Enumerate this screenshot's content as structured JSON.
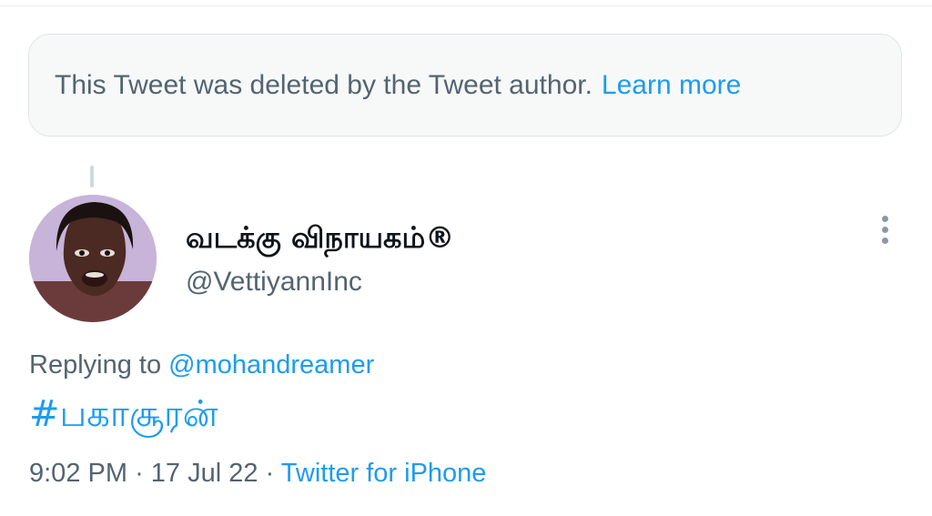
{
  "deleted_notice": {
    "text": "This Tweet was deleted by the Tweet author.",
    "link": "Learn more"
  },
  "tweet": {
    "display_name": "வடக்கு விநாயகம்®",
    "handle": "@VettiyannInc",
    "replying_prefix": "Replying to",
    "replying_to": "@mohandreamer",
    "body": "#பகாசூரன்",
    "time": "9:02 PM",
    "date": "17 Jul 22",
    "separator": "·",
    "source": "Twitter for iPhone"
  },
  "colors": {
    "link": "#1d9bf0",
    "secondary_text": "#536471",
    "primary_text": "#0f1419",
    "notice_bg": "#f7f9f9"
  },
  "icons": {
    "more": "more-vertical-icon",
    "avatar": "avatar"
  }
}
